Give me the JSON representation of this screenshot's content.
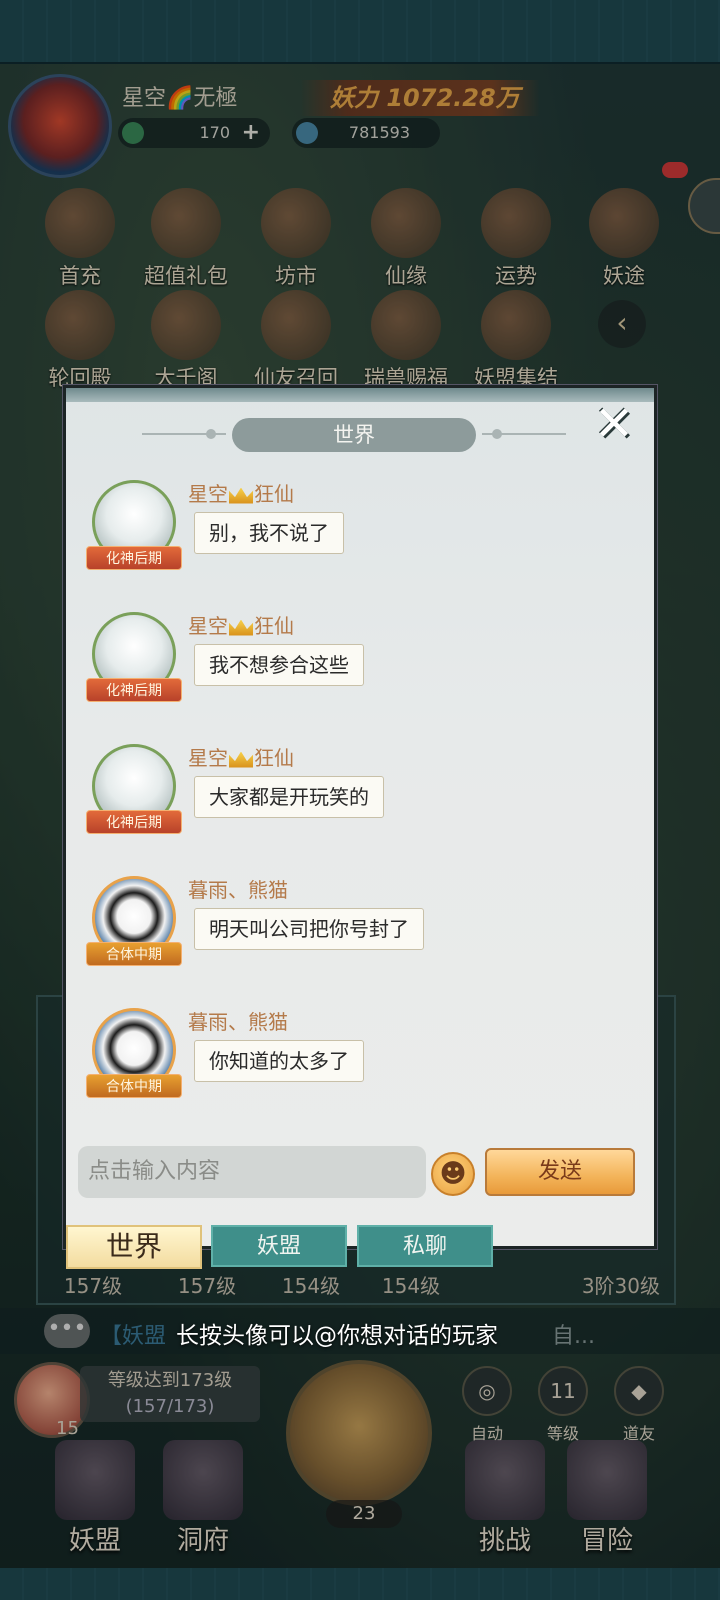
{
  "player": {
    "name": "星空🌈无極",
    "power_label": "妖力",
    "power_value": "1072.28万",
    "currency_1": "170",
    "currency_2": "781593"
  },
  "top_icons_row1": [
    "首充",
    "超值礼包",
    "坊市",
    "仙缘",
    "运势",
    "妖途"
  ],
  "top_icons_row2": [
    "轮回殿",
    "大千阁",
    "仙友召回",
    "瑞兽赐福",
    "妖盟集结"
  ],
  "background": {
    "levels": [
      "157级",
      "157级",
      "154级",
      "154级"
    ],
    "rank": "3阶30级",
    "guild_tag": "【妖盟",
    "tip_tail": "自...",
    "peach_count": "15",
    "quest_title": "等级达到173级",
    "quest_progress": "(157/173)",
    "axe_count": "23",
    "round_buttons": [
      {
        "icon": "auto-icon",
        "label": "自动",
        "symbol": "◎"
      },
      {
        "icon": "level-icon",
        "label": "等级",
        "symbol": "11"
      },
      {
        "icon": "friend-icon",
        "label": "道友",
        "symbol": "◆"
      }
    ],
    "nav": [
      "妖盟",
      "洞府",
      "挑战",
      "冒险"
    ]
  },
  "chat": {
    "title": "世界",
    "close_symbol": "✕",
    "messages": [
      {
        "sender_a": "星空",
        "sender_b": "狂仙",
        "crown": true,
        "realm": "化神后期",
        "text": "别，我不说了",
        "avatar": "white-hair-avatar"
      },
      {
        "sender_a": "星空",
        "sender_b": "狂仙",
        "crown": true,
        "realm": "化神后期",
        "text": "我不想参合这些",
        "avatar": "white-hair-avatar"
      },
      {
        "sender_a": "星空",
        "sender_b": "狂仙",
        "crown": true,
        "realm": "化神后期",
        "text": "大家都是开玩笑的",
        "avatar": "white-hair-avatar"
      },
      {
        "sender_a": "暮雨、熊猫",
        "sender_b": "",
        "crown": false,
        "realm": "合体中期",
        "text": "明天叫公司把你号封了",
        "avatar": "panda-avatar"
      },
      {
        "sender_a": "暮雨、熊猫",
        "sender_b": "",
        "crown": false,
        "realm": "合体中期",
        "text": "你知道的太多了",
        "avatar": "panda-avatar"
      }
    ],
    "input_placeholder": "点击输入内容",
    "send_label": "发送"
  },
  "tabs": {
    "world": "世界",
    "guild": "妖盟",
    "private": "私聊"
  },
  "tip": "长按头像可以@你想对话的玩家",
  "colors": {
    "sender": "#b47a4a",
    "realm_badge": "#e26a3a",
    "tab_active": "#f3dca0",
    "tab_inactive": "#3f8f8a",
    "send_button": "#f3b45a"
  }
}
